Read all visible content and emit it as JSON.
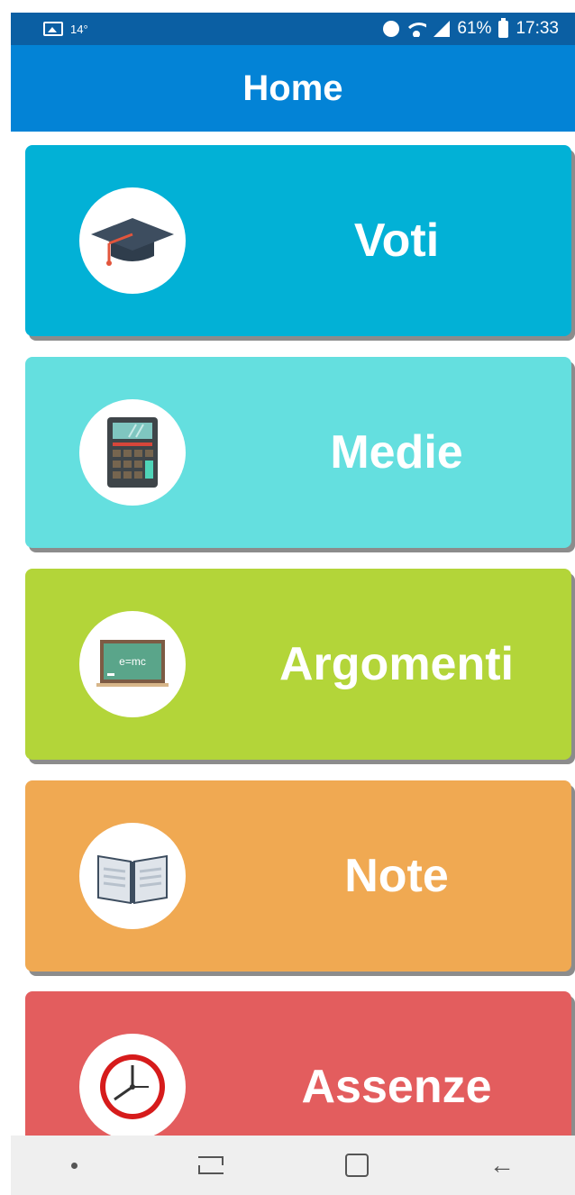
{
  "status_bar": {
    "temperature": "14°",
    "battery": "61%",
    "time": "17:33"
  },
  "app_bar": {
    "title": "Home"
  },
  "menu": {
    "items": [
      {
        "label": "Voti",
        "icon": "graduation-cap-icon",
        "color": "#02b1d6"
      },
      {
        "label": "Medie",
        "icon": "calculator-icon",
        "color": "#64dfdf"
      },
      {
        "label": "Argomenti",
        "icon": "blackboard-icon",
        "color": "#b3d539"
      },
      {
        "label": "Note",
        "icon": "open-book-icon",
        "color": "#f0a952"
      },
      {
        "label": "Assenze",
        "icon": "clock-icon",
        "color": "#e35d5e"
      }
    ],
    "blackboard_text": "e=mc"
  },
  "nav_bar": {
    "items": [
      "dot-icon",
      "recent-apps-icon",
      "home-icon",
      "back-icon"
    ]
  }
}
